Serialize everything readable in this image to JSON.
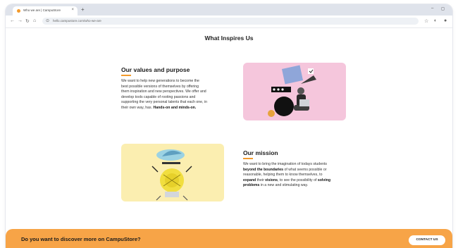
{
  "browser": {
    "tab_title": "Who we are | CampuStore",
    "tab_close": "×",
    "new_tab": "+",
    "url": "hello.campustore.com/who-we-are",
    "win_minimize": "–",
    "win_maximize": "◻"
  },
  "page": {
    "title": "What Inspires Us",
    "values": {
      "heading": "Our values and purpose",
      "lines": [
        "We want to help new generations to become the",
        "best possible versions of themselves by offering",
        "them inspiration and new perspectives. We offer and",
        "develop tools capable of rooting passions and",
        "supporting the very personal talents that each one, in",
        "their own way, has."
      ],
      "bold_end": "Hands-on and minds-on."
    },
    "mission": {
      "heading": "Our mission",
      "line1": "We want to bring the imagination of todays students",
      "line2_bold": "beyond the boundaries",
      "line2_rest": " of what seems possible or",
      "line3": "reasonable, helping them to know themselves, to",
      "line4_bold": "expand",
      "line4_mid": " their ",
      "line4_bold2": "visions",
      "line4_rest": ", to see the possibility of ",
      "line4_bold3": "solving",
      "line5_bold": "problems",
      "line5_rest": " in a new and stimulating way."
    },
    "colors": {
      "pink_card": "#f5c6dc",
      "yellow_card": "#fbeeb0",
      "accent": "#f39a2b",
      "banner": "#f7a447"
    }
  },
  "banner": {
    "text": "Do you want to discover more on CampuStore?",
    "button": "CONTACT US"
  }
}
